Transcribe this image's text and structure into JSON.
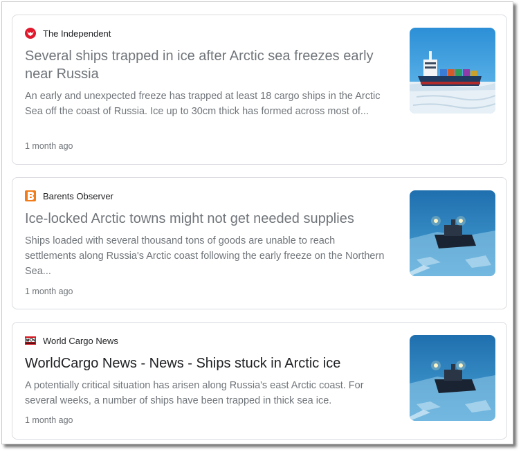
{
  "articles": [
    {
      "source": "The Independent",
      "source_icon": "independent-eagle-logo",
      "title": "Several ships trapped in ice after Arctic sea freezes early near Russia",
      "snippet": "An early and unexpected freeze has trapped at least 18 cargo ships in the Arctic Sea off the coast of Russia. Ice up to 30cm thick has formed across most of...",
      "age": "1 month ago",
      "thumbnail": "cargo-ship-in-ice-image"
    },
    {
      "source": "Barents Observer",
      "source_icon": "barents-observer-logo",
      "title": "Ice-locked Arctic towns might not get needed supplies",
      "snippet": "Ships loaded with several thousand tons of goods are unable to reach settlements along Russia's Arctic coast following the early freeze on the Northern Sea...",
      "age": "1 month ago",
      "thumbnail": "ship-in-arctic-ice-image"
    },
    {
      "source": "World Cargo News",
      "source_icon": "world-cargo-news-logo",
      "title": "WorldCargo News - News - Ships stuck in Arctic ice",
      "snippet": "A potentially critical situation has arisen along Russia's east Arctic coast. For several weeks, a number of ships have been trapped in thick sea ice.",
      "age": "1 month ago",
      "thumbnail": "ship-in-arctic-ice-image"
    }
  ],
  "colors": {
    "independent_red": "#e0192d",
    "barents_orange": "#f07d1a",
    "wcn_red": "#d4111b",
    "title_gray": "#70757a",
    "title_dark": "#202124"
  }
}
